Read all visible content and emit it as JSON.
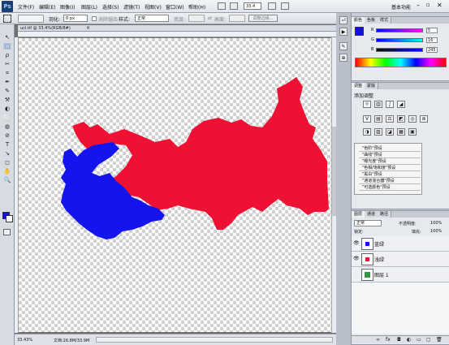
{
  "menubar": {
    "logo": "Ps",
    "items": [
      "文件(F)",
      "编辑(E)",
      "图像(I)",
      "图层(L)",
      "选择(S)",
      "滤镜(T)",
      "视图(V)",
      "窗口(W)",
      "帮助(H)"
    ],
    "zoom": "33.4",
    "workspace": "基本功能"
  },
  "options": {
    "feather_label": "羽化:",
    "feather_value": "0 px",
    "antialias": "消除锯齿",
    "style_label": "样式:",
    "style_value": "正常",
    "width_label": "宽度:",
    "height_label": "高度:",
    "refine_button": "调整边缘..."
  },
  "document": {
    "tab_title": "ucl.tif @ 33.4%(RGB/8#)"
  },
  "toolbox": {
    "tools": [
      "↖",
      "⬚",
      "ρ",
      "✂",
      "⌗",
      "✒",
      "✎",
      "⚒",
      "◐",
      "⬜",
      "◍",
      "⊘",
      "T",
      "↘",
      "◻",
      "✋",
      "🔍"
    ]
  },
  "colors": {
    "foreground": "#1010e0",
    "background": "#ffffff",
    "red_shape": "#ee1133",
    "blue_shape": "#1414ee"
  },
  "color_panel": {
    "tabs": [
      "颜色",
      "色板",
      "样式"
    ],
    "r_label": "R",
    "r_value": "5",
    "g_label": "G",
    "g_value": "16",
    "b_label": "B",
    "b_value": "245"
  },
  "adjust_panel": {
    "tabs": [
      "调整",
      "蒙版"
    ],
    "title": "添加调整",
    "presets": [
      "\"色阶\"预设",
      "\"曲线\"预设",
      "\"曝光度\"预设",
      "\"色相/饱和度\"预设",
      "\"黑白\"预设",
      "\"通道混合器\"预设",
      "\"可选颜色\"预设"
    ]
  },
  "layers_panel": {
    "tabs": [
      "图层",
      "通道",
      "路径"
    ],
    "blend_mode": "正常",
    "opacity_label": "不透明度:",
    "opacity_value": "100%",
    "lock_label": "锁定:",
    "fill_label": "填充:",
    "fill_value": "100%",
    "layers": [
      {
        "name": "蓝绿"
      },
      {
        "name": "浅绿"
      },
      {
        "name": "图层 1"
      }
    ]
  },
  "status": {
    "zoom": "33.43%",
    "doc": "文档:26.8M/33.9M"
  }
}
